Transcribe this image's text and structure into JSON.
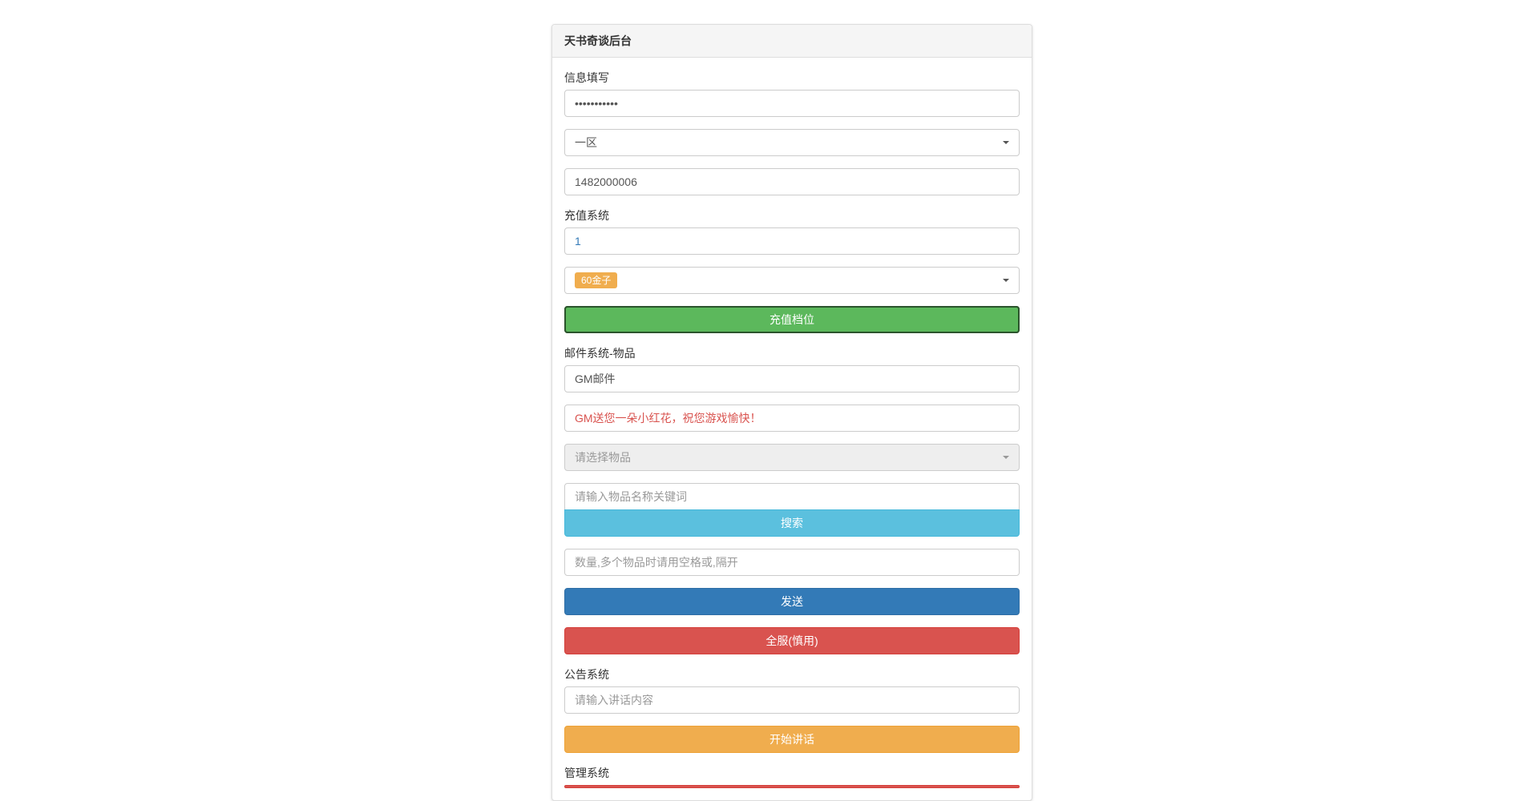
{
  "panel": {
    "title": "天书奇谈后台"
  },
  "info_section": {
    "label": "信息填写",
    "password_value": "•••••••••••",
    "zone_selected": "一区",
    "uid_value": "1482000006"
  },
  "recharge_section": {
    "label": "充值系统",
    "amount_value": "1",
    "tier_badge": "60金子",
    "submit_label": "充值档位"
  },
  "mail_section": {
    "label": "邮件系统-物品",
    "title_value": "GM邮件",
    "body_value": "GM送您一朵小红花，祝您游戏愉快！",
    "item_select_placeholder": "请选择物品",
    "search_placeholder": "请输入物品名称关键词",
    "search_button": "搜索",
    "quantity_placeholder": "数量,多个物品时请用空格或,隔开",
    "send_button": "发送",
    "all_server_button": "全服(慎用)"
  },
  "announce_section": {
    "label": "公告系统",
    "content_placeholder": "请输入讲话内容",
    "speak_button": "开始讲话"
  },
  "manage_section": {
    "label": "管理系统"
  }
}
